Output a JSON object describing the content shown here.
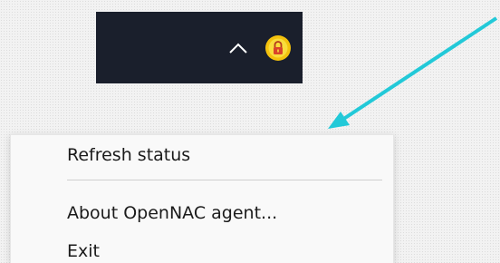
{
  "taskbar": {
    "overflow_icon": "chevron-up-icon",
    "app_icon": "opennac-agent-lock-icon",
    "background_color": "#1a1f2c"
  },
  "annotation": {
    "arrow_color": "#22c9d8"
  },
  "context_menu": {
    "items": [
      {
        "label": "Refresh status"
      },
      {
        "label": "About OpenNAC agent..."
      },
      {
        "label": "Exit"
      }
    ]
  }
}
